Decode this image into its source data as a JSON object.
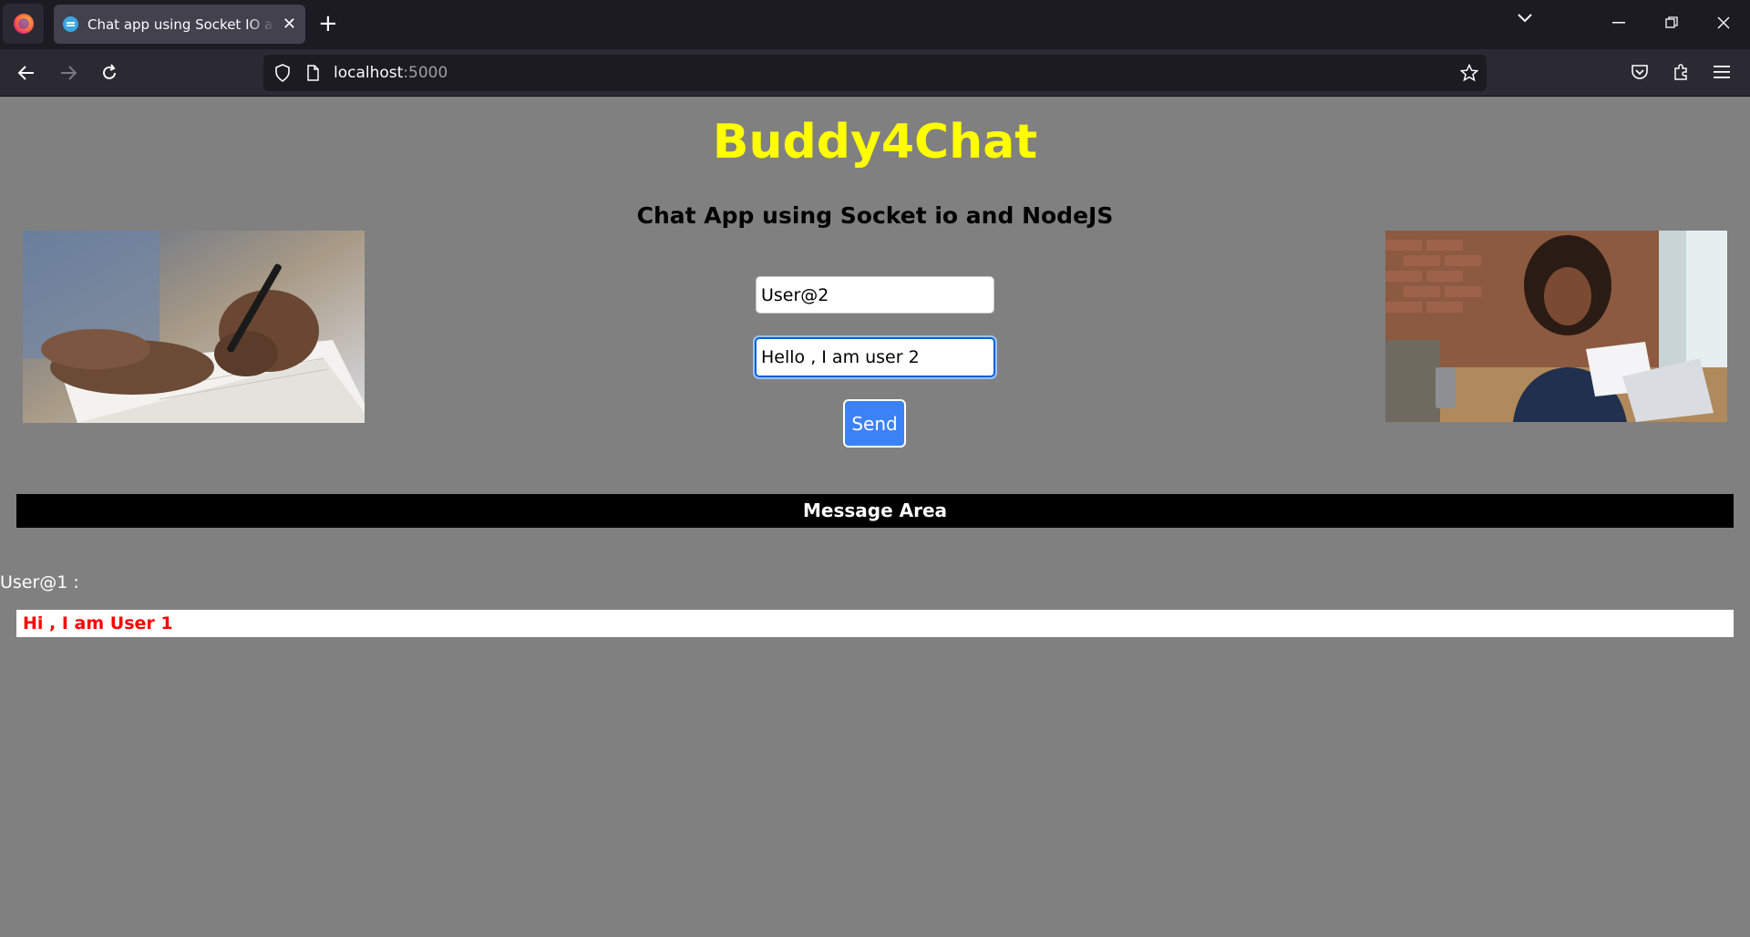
{
  "browser": {
    "tab_title": "Chat app using Socket IO and Node JS",
    "url_host": "localhost",
    "url_port": ":5000"
  },
  "page": {
    "brand": "Buddy4Chat",
    "subtitle": "Chat App using Socket io and NodeJS",
    "name_value": "User@2",
    "message_value": "Hello , I am user 2",
    "send_label": "Send",
    "message_area_title": "Message Area",
    "messages": [
      {
        "sender": "User@1 :",
        "text": "Hi , I am User 1"
      }
    ]
  },
  "colors": {
    "page_background": "#808080",
    "brand": "#ffff00",
    "send_button": "#3b82f6",
    "message_text": "#ff0000"
  }
}
